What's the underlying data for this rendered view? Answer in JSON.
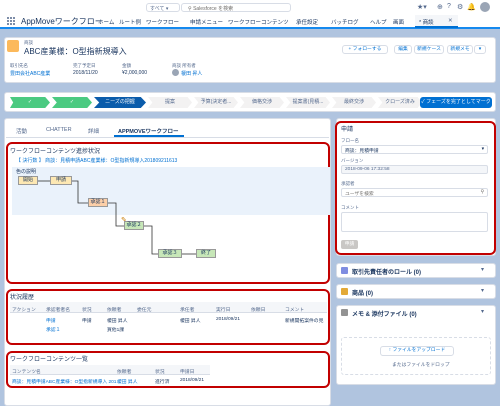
{
  "header": {
    "search_scope": "すべて",
    "search_placeholder": "Salesforce を検索",
    "app_name": "AppMoveワークフロー",
    "nav": [
      "ホーム",
      "ルート例",
      "ワークフロー",
      "申請メニュー",
      "ワークフローコンテンツ",
      "承任設定",
      "バッチログ",
      "ヘルプ",
      "画面",
      "* 商談"
    ]
  },
  "record": {
    "object_label": "商談",
    "title": "ABC産業様：O型指新規導入",
    "follow_button": "+ フォローする",
    "actions": [
      "編集",
      "新規ケース",
      "新規メモ"
    ],
    "fields": [
      {
        "label": "取引先名",
        "value": "豊田会社ABC産業"
      },
      {
        "label": "完了予定日",
        "value": "2018/11/20"
      },
      {
        "label": "金額",
        "value": "¥2,000,000"
      },
      {
        "label": "商談 所有者",
        "value": "榎田 昇人"
      }
    ]
  },
  "path": {
    "steps": [
      "",
      "",
      "ニーズの把握",
      "提案",
      "予算(決定者...",
      "価格交渉",
      "提案書(見積...",
      "最終交渉",
      "クローズ済み"
    ],
    "complete_button": "✓ フェーズを完了としてマーク"
  },
  "tabs": [
    "活動",
    "CHATTER",
    "詳細",
    "APPMOVEワークフロー"
  ],
  "workflow_status": {
    "title": "ワークフローコンテンツ進捗状況",
    "summary": "【 決行数 】 商談：見積申請ABC産業様：O型指新規導入201809211613",
    "legend": "色の説明",
    "nodes": [
      "開始",
      "申請",
      "承認１",
      "承認２",
      "承認３",
      "終了"
    ]
  },
  "history": {
    "title": "状況履歴",
    "columns": [
      "アクション",
      "承認者者名",
      "状況",
      "依頼者",
      "委任元",
      "承任者",
      "実行日",
      "依頼日",
      "コメント"
    ],
    "rows": [
      [
        "",
        "申請",
        "申請",
        "榎田 昇人",
        "",
        "榎田 昇人",
        "2018/09/21",
        "",
        "新規開拓案件の見"
      ],
      [
        "",
        "承認１",
        "",
        "買他1課",
        "",
        "",
        "",
        "",
        ""
      ]
    ]
  },
  "contents_list": {
    "title": "ワークフローコンテンツ一覧",
    "columns": [
      "コンテンツ名",
      "依頼者",
      "状況",
      "申請日"
    ],
    "row": [
      "商談：見積申請ABC産業様：O型指新規導入 201...",
      "榎田 昇人",
      "進行済",
      "2018/09/21"
    ]
  },
  "application": {
    "title": "申請",
    "flow_label": "フロー名",
    "flow_value": "商談：見積申請",
    "version_label": "バージョン",
    "version_value": "2018-09-06 17:32:58",
    "approver_label": "承認者",
    "approver_placeholder": "ユーザを検索",
    "comment_label": "コメント",
    "submit": "申請"
  },
  "related": [
    {
      "title": "取引先責任者のロール (0)",
      "color": "#7f8de1"
    },
    {
      "title": "商品 (0)",
      "color": "#e3a937"
    },
    {
      "title": "メモ & 添付ファイル (0)",
      "color": "#939393"
    }
  ],
  "upload": {
    "button": "↑ ファイルをアップロード",
    "hint": "またはファイルをドロップ"
  }
}
